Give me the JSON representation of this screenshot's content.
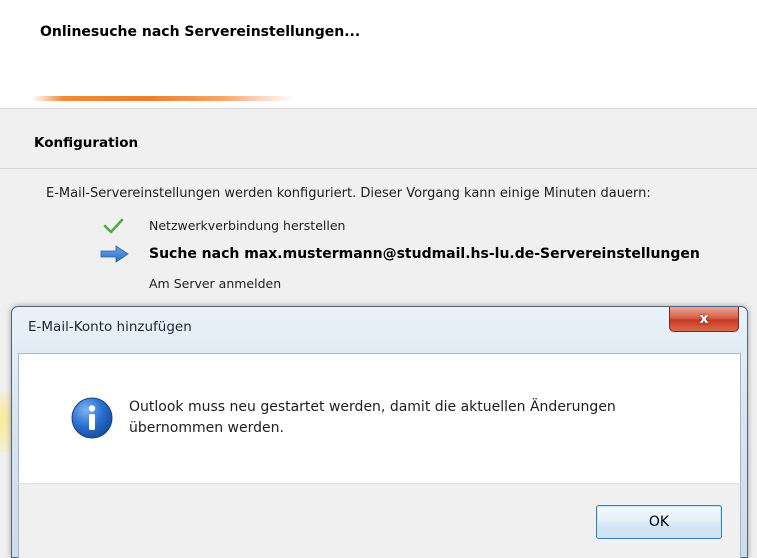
{
  "wizard": {
    "heading": "Onlinesuche nach Servereinstellungen...",
    "progress_indeterminate": true,
    "section_title": "Konfiguration",
    "description": "E-Mail-Servereinstellungen werden konfiguriert. Dieser Vorgang kann einige Minuten dauern:",
    "steps": [
      {
        "status": "done",
        "icon": "checkmark-icon",
        "label": "Netzwerkverbindung herstellen"
      },
      {
        "status": "current",
        "icon": "arrow-right-icon",
        "label": "Suche nach max.mustermann@studmail.hs-lu.de-Servereinstellungen"
      },
      {
        "status": "pending",
        "icon": "",
        "label": "Am Server anmelden"
      }
    ]
  },
  "dialog": {
    "title": "E-Mail-Konto hinzufügen",
    "close_label": "x",
    "icon": "info-icon",
    "message": "Outlook muss neu gestartet werden, damit die aktuellen Änderungen übernommen werden.",
    "ok_label": "OK"
  },
  "colors": {
    "progress": "#ee7f2e",
    "check": "#4caf3a",
    "arrow": "#3b7dd8",
    "info_icon": "#1f5fb8",
    "close_button": "#c73a24"
  }
}
